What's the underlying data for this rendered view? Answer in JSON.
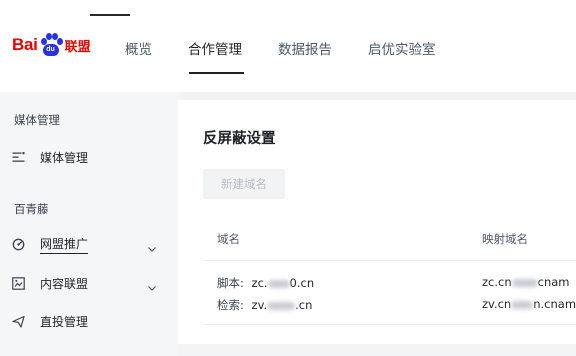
{
  "header": {
    "logo": {
      "text_bai": "Bai",
      "text_du": "du",
      "text_lm": "联盟"
    },
    "tabs": [
      {
        "label": "概览",
        "active": false
      },
      {
        "label": "合作管理",
        "active": true
      },
      {
        "label": "数据报告",
        "active": false
      },
      {
        "label": "启优实验室",
        "active": false
      }
    ]
  },
  "sidebar": {
    "sections": [
      {
        "title": "媒体管理",
        "items": [
          {
            "label": "媒体管理",
            "icon": "list-icon",
            "expandable": false
          }
        ]
      },
      {
        "title": "百青藤",
        "items": [
          {
            "label": "网盟推广",
            "icon": "target-icon",
            "expandable": true,
            "underlined": true
          },
          {
            "label": "内容联盟",
            "icon": "image-icon",
            "expandable": true
          },
          {
            "label": "直投管理",
            "icon": "send-icon",
            "expandable": false
          }
        ]
      }
    ]
  },
  "main": {
    "title": "反屏蔽设置",
    "new_domain_button": "新建域名",
    "table": {
      "columns": [
        "域名",
        "映射域名"
      ],
      "rows": [
        {
          "lines": [
            {
              "key": "脚本:",
              "domain_prefix": "zc.",
              "domain_suffix": "0.cn",
              "mapped_prefix": "zc.cn",
              "mapped_suffix": "cnam"
            },
            {
              "key": "检索:",
              "domain_prefix": "zv.",
              "domain_suffix": ".cn",
              "mapped_prefix": "zv.cn",
              "mapped_suffix": "n.cnam"
            }
          ]
        }
      ]
    }
  },
  "colors": {
    "brand_red": "#e10602",
    "brand_blue": "#2932e1",
    "text_primary": "#1f2329",
    "text_secondary": "#4e5969",
    "sidebar_bg": "#f5f6f8",
    "disabled_button_bg": "#f2f3f5",
    "disabled_button_text": "#b7bcc6"
  }
}
